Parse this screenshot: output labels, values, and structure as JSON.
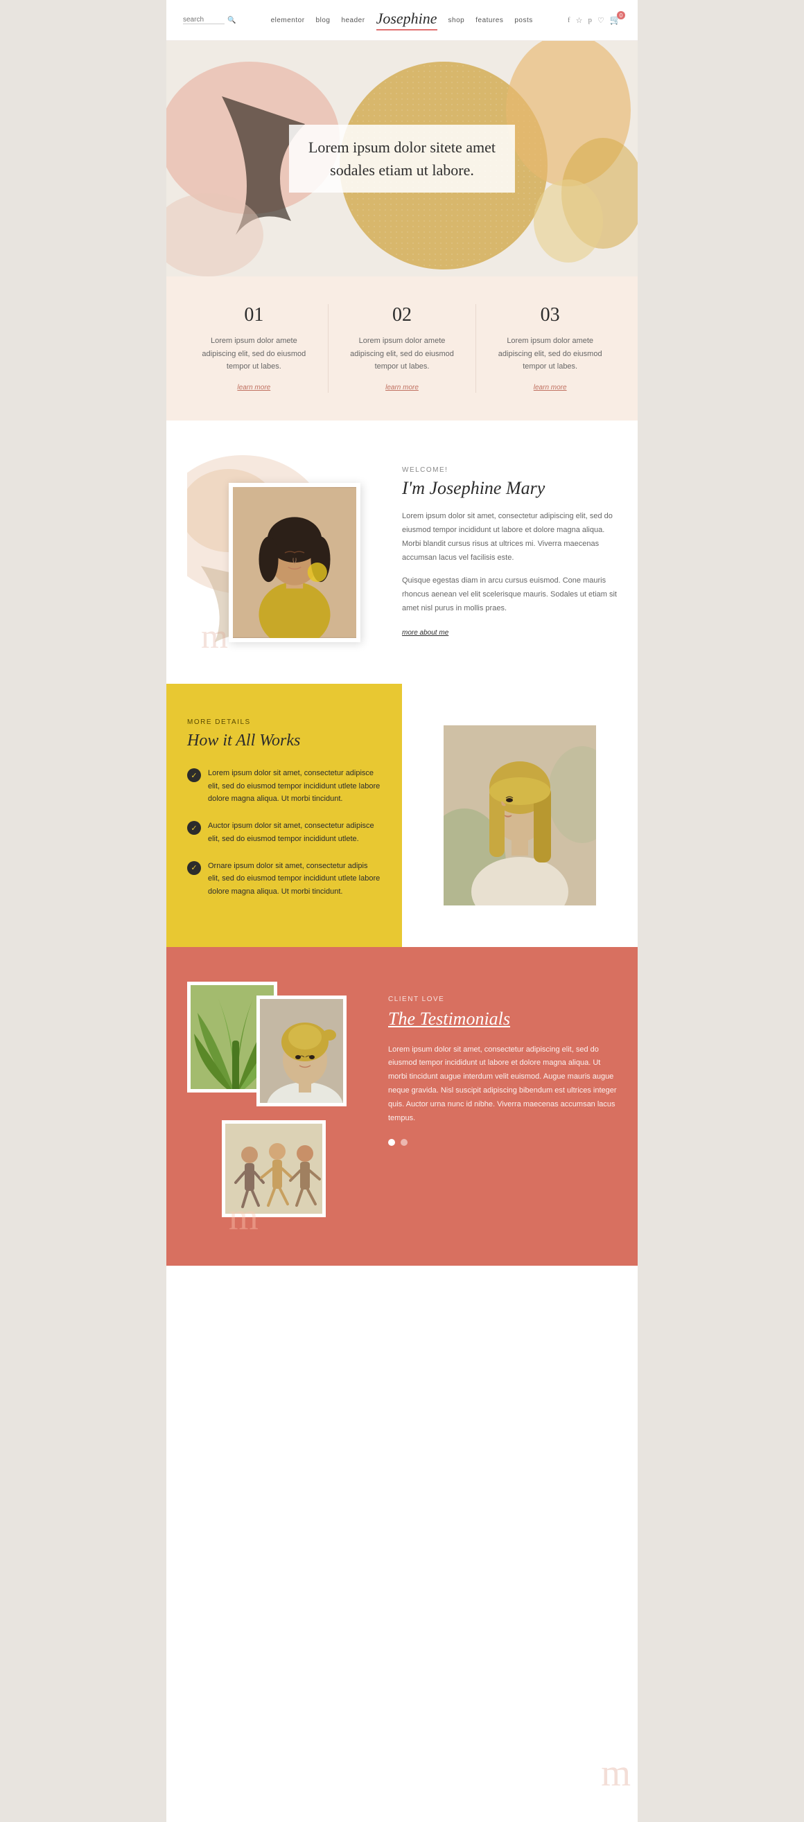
{
  "nav": {
    "search_placeholder": "search",
    "search_icon": "🔍",
    "links_left": [
      "elementor",
      "blog",
      "header"
    ],
    "brand": "Josephine",
    "links_right": [
      "shop",
      "features",
      "posts"
    ],
    "social_icons": [
      "f",
      "☆",
      "p"
    ],
    "cart_count": "0"
  },
  "hero": {
    "title_line1": "Lorem ipsum dolor sitete amet",
    "title_line2": "sodales etiam ut labore."
  },
  "features": {
    "items": [
      {
        "number": "01",
        "text": "Lorem ipsum dolor amete adipiscing elit, sed do eiusmod tempor ut labes.",
        "link": "learn more"
      },
      {
        "number": "02",
        "text": "Lorem ipsum dolor amete adipiscing elit, sed do eiusmod tempor ut labes.",
        "link": "learn more"
      },
      {
        "number": "03",
        "text": "Lorem ipsum dolor amete adipiscing elit, sed do eiusmod tempor ut labes.",
        "link": "learn more"
      }
    ]
  },
  "about": {
    "welcome_label": "WELCOME!",
    "name": "I'm Josephine Mary",
    "para1": "Lorem ipsum dolor sit amet, consectetur adipiscing elit, sed do eiusmod tempor incididunt ut labore et dolore magna aliqua. Morbi blandit cursus risus at ultrices mi. Viverra maecenas accumsan lacus vel facilisis este.",
    "para2": "Quisque egestas diam in arcu cursus euismod. Cone mauris rhoncus aenean vel elit scelerisque mauris. Sodales ut etiam sit amet nisl purus in mollis praes.",
    "more_link": "more about me"
  },
  "how_works": {
    "subtitle": "MORE DETAILS",
    "title": "How it All Works",
    "items": [
      {
        "text": "Lorem ipsum dolor sit amet, consectetur adipisce elit, sed do eiusmod tempor incididunt utlete labore dolore magna aliqua. Ut morbi tincidunt."
      },
      {
        "text": "Auctor ipsum dolor sit amet, consectetur adipisce elit, sed do eiusmod tempor incididunt utlete."
      },
      {
        "text": "Ornare ipsum dolor sit amet, consectetur adipis elit, sed do eiusmod tempor incididunt utlete labore dolore magna aliqua. Ut morbi tincidunt."
      }
    ]
  },
  "testimonials": {
    "label": "CLIENT LOVE",
    "title_prefix": "The ",
    "title_highlight": "Testimonials",
    "text": "Lorem ipsum dolor sit amet, consectetur adipiscing elit, sed do eiusmod tempor incididunt ut labore et dolore magna aliqua. Ut morbi tincidunt augue interdum velit euismod. Augue mauris augue neque gravida. Nisl suscipit adipiscing bibendum est ultrices integer quis. Auctor urna nunc id nibhe. Viverra maecenas accumsan lacus tempus.",
    "dots": [
      true,
      false
    ]
  },
  "colors": {
    "accent_red": "#e07070",
    "accent_yellow": "#e8c832",
    "accent_peach": "#f9ede4",
    "accent_terracotta": "#d87060"
  }
}
